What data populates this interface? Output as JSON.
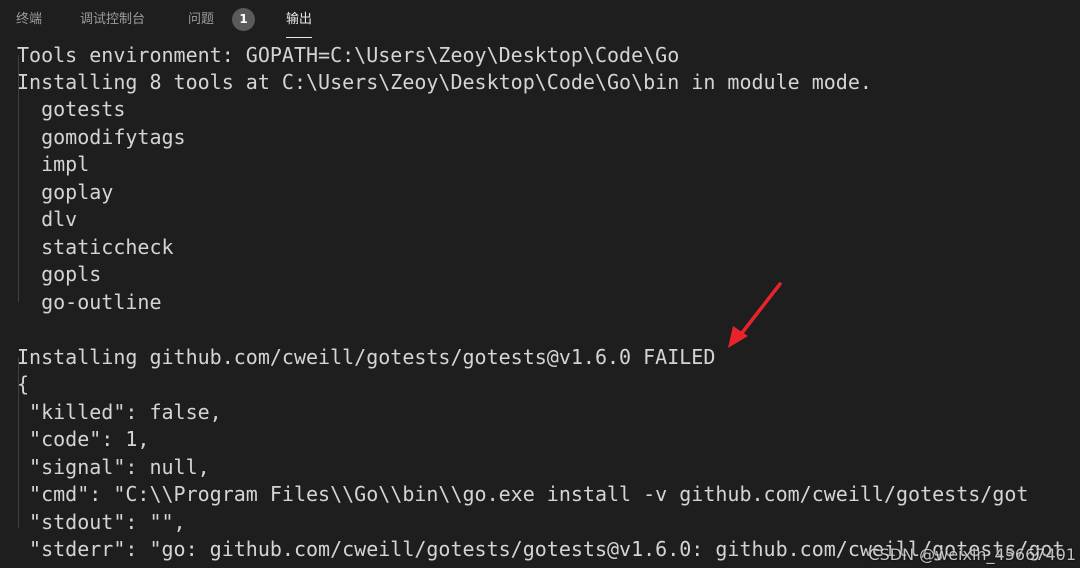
{
  "tabs": [
    {
      "label": "终端"
    },
    {
      "label": "调试控制台"
    },
    {
      "label": "问题",
      "badge": "1"
    },
    {
      "label": "输出"
    }
  ],
  "output": {
    "lines": [
      "Tools environment: GOPATH=C:\\Users\\Zeoy\\Desktop\\Code\\Go",
      "Installing 8 tools at C:\\Users\\Zeoy\\Desktop\\Code\\Go\\bin in module mode.",
      "  gotests",
      "  gomodifytags",
      "  impl",
      "  goplay",
      "  dlv",
      "  staticcheck",
      "  gopls",
      "  go-outline",
      "",
      "Installing github.com/cweill/gotests/gotests@v1.6.0 FAILED",
      "{",
      " \"killed\": false,",
      " \"code\": 1,",
      " \"signal\": null,",
      " \"cmd\": \"C:\\\\Program Files\\\\Go\\\\bin\\\\go.exe install -v github.com/cweill/gotests/got",
      " \"stdout\": \"\",",
      " \"stderr\": \"go: github.com/cweill/gotests/gotests@v1.6.0: github.com/cweill/gotests/got"
    ]
  },
  "watermark": "CSDN @weixin_45667401",
  "colors": {
    "background": "#1e1e1e",
    "text": "#d4d4d4",
    "arrow": "#e8232a"
  }
}
